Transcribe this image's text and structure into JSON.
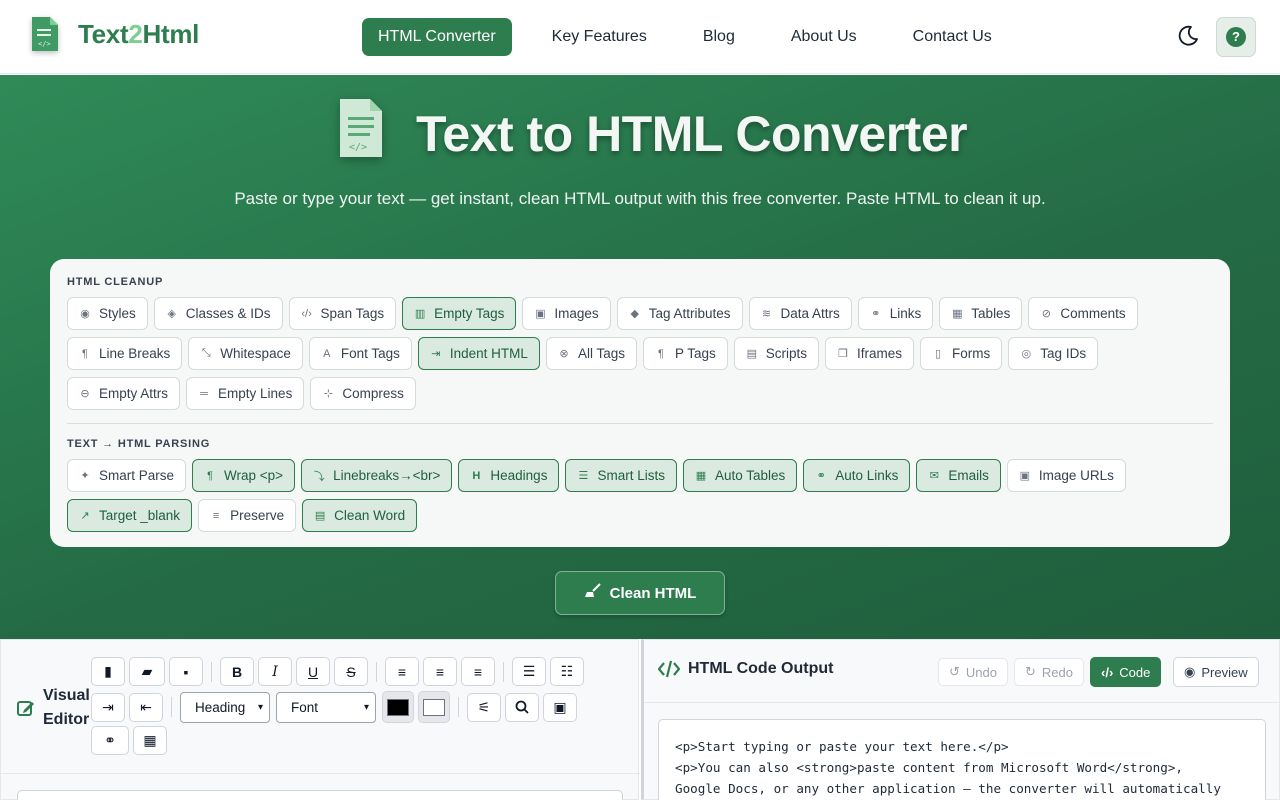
{
  "brand": {
    "name_part1": "Text",
    "name_part2": "2",
    "name_part3": "Html"
  },
  "colors": {
    "primary": "#2e7d4f",
    "hero_bg": "#246b45",
    "panel_bg": "#f6f8f7",
    "chip_active_bg": "#dbeae0"
  },
  "nav": {
    "items": [
      {
        "label": "HTML Converter",
        "active": true
      },
      {
        "label": "Key Features"
      },
      {
        "label": "Blog"
      },
      {
        "label": "About Us"
      },
      {
        "label": "Contact Us"
      }
    ],
    "help_label": "?"
  },
  "hero": {
    "title": "Text to HTML Converter",
    "subtitle": "Paste or type your text — get instant, clean HTML output with this free converter. Paste HTML to clean it up."
  },
  "cleanup": {
    "label": "HTML CLEANUP",
    "rows": [
      [
        {
          "label": "Styles",
          "icon": "palette-icon",
          "on": false
        },
        {
          "label": "Classes & IDs",
          "icon": "layers-icon",
          "on": false
        },
        {
          "label": "Span Tags",
          "icon": "code-icon",
          "on": false
        },
        {
          "label": "Empty Tags",
          "icon": "trash-icon",
          "on": true
        },
        {
          "label": "Images",
          "icon": "image-icon",
          "on": false
        },
        {
          "label": "Tag Attributes",
          "icon": "tag-icon",
          "on": false
        },
        {
          "label": "Data Attrs",
          "icon": "database-icon",
          "on": false
        },
        {
          "label": "Links",
          "icon": "unlink-icon",
          "on": false
        },
        {
          "label": "Tables",
          "icon": "table-icon",
          "on": false
        },
        {
          "label": "Comments",
          "icon": "comment-slash-icon",
          "on": false
        }
      ],
      [
        {
          "label": "Line Breaks",
          "icon": "paragraph-icon",
          "on": false
        },
        {
          "label": "Whitespace",
          "icon": "compress-arrows-icon",
          "on": false
        },
        {
          "label": "Font Tags",
          "icon": "font-icon",
          "on": false
        },
        {
          "label": "Indent HTML",
          "icon": "indent-icon",
          "on": true
        },
        {
          "label": "All Tags",
          "icon": "x-circle-icon",
          "on": false
        },
        {
          "label": "P Tags",
          "icon": "paragraph-icon",
          "on": false
        },
        {
          "label": "Scripts",
          "icon": "file-code-icon",
          "on": false
        },
        {
          "label": "Iframes",
          "icon": "window-icon",
          "on": false
        },
        {
          "label": "Forms",
          "icon": "form-icon",
          "on": false
        },
        {
          "label": "Tag IDs",
          "icon": "fingerprint-icon",
          "on": false
        }
      ],
      [
        {
          "label": "Empty Attrs",
          "icon": "minus-circle-icon",
          "on": false
        },
        {
          "label": "Empty Lines",
          "icon": "lines-icon",
          "on": false
        },
        {
          "label": "Compress",
          "icon": "compress-icon",
          "on": false
        }
      ]
    ]
  },
  "parsing": {
    "label": "TEXT → HTML PARSING",
    "rows": [
      [
        {
          "label": "Smart Parse",
          "icon": "magic-wand-icon",
          "on": false
        },
        {
          "label": "Wrap <p>",
          "icon": "paragraph-icon",
          "on": true
        },
        {
          "label": "Linebreaks→<br>",
          "icon": "level-down-icon",
          "on": true
        },
        {
          "label": "Headings",
          "icon": "heading-icon",
          "on": true
        },
        {
          "label": "Smart Lists",
          "icon": "list-icon",
          "on": true
        },
        {
          "label": "Auto Tables",
          "icon": "table-icon",
          "on": true
        },
        {
          "label": "Auto Links",
          "icon": "link-icon",
          "on": true
        },
        {
          "label": "Emails",
          "icon": "envelope-icon",
          "on": true
        },
        {
          "label": "Image URLs",
          "icon": "image-icon",
          "on": false
        }
      ],
      [
        {
          "label": "Target _blank",
          "icon": "external-link-icon",
          "on": true
        },
        {
          "label": "Preserve",
          "icon": "align-left-icon",
          "on": false
        },
        {
          "label": "Clean Word",
          "icon": "file-word-icon",
          "on": true
        }
      ]
    ]
  },
  "clean_button": {
    "label": "Clean HTML"
  },
  "editor": {
    "title_line1": "Visual",
    "title_line2": "Editor",
    "heading_select": "Heading",
    "font_select": "Font",
    "fore_color": "#000000",
    "back_color": "#ffffff"
  },
  "output": {
    "title": "HTML Code Output",
    "undo": "Undo",
    "redo": "Redo",
    "code_tab": "Code",
    "preview_tab": "Preview",
    "code_lines": [
      "<p>Start typing or paste your text here.</p>",
      "<p>You can also <strong>paste content from Microsoft Word</strong>,",
      "Google Docs, or any other application — the converter will automatically"
    ]
  }
}
